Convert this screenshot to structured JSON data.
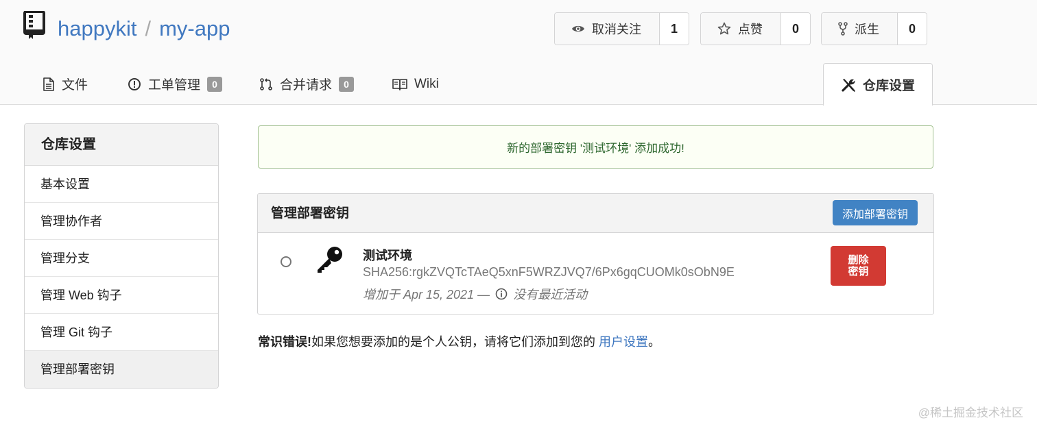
{
  "repo": {
    "owner": "happykit",
    "separator": "/",
    "name": "my-app"
  },
  "actions": [
    {
      "label": "取消关注",
      "count": "1",
      "icon": "eye-icon"
    },
    {
      "label": "点赞",
      "count": "0",
      "icon": "star-icon"
    },
    {
      "label": "派生",
      "count": "0",
      "icon": "fork-icon"
    }
  ],
  "tabs": {
    "files": {
      "label": "文件",
      "icon": "file-icon"
    },
    "issues": {
      "label": "工单管理",
      "badge": "0",
      "icon": "issue-icon"
    },
    "pulls": {
      "label": "合并请求",
      "badge": "0",
      "icon": "pull-request-icon"
    },
    "wiki": {
      "label": "Wiki",
      "icon": "book-icon"
    },
    "settings": {
      "label": "仓库设置",
      "icon": "tools-icon"
    }
  },
  "sidebar": {
    "title": "仓库设置",
    "items": [
      {
        "label": "基本设置"
      },
      {
        "label": "管理协作者"
      },
      {
        "label": "管理分支"
      },
      {
        "label": "管理 Web 钩子"
      },
      {
        "label": "管理 Git 钩子"
      },
      {
        "label": "管理部署密钥"
      }
    ]
  },
  "alert": {
    "message": "新的部署密钥 '测试环境' 添加成功!"
  },
  "deploy_keys": {
    "title": "管理部署密钥",
    "add_button": "添加部署密钥",
    "key": {
      "name": "测试环境",
      "fingerprint": "SHA256:rgkZVQTcTAeQ5xnF5WRZJVQ7/6Px6gqCUOMk0sObN9E",
      "added": "增加于 Apr 15, 2021 —",
      "activity": "没有最近活动",
      "delete_line1": "删除",
      "delete_line2": "密钥"
    }
  },
  "note": {
    "bold": "常识错误!",
    "text": "如果您想要添加的是个人公钥，请将它们添加到您的",
    "link": "用户设置",
    "end": "。"
  },
  "watermark": "@稀土掘金技术社区",
  "colors": {
    "link": "#4078c0",
    "primary_button": "#4183c4",
    "danger_button": "#d23a33",
    "success_text": "#2c662d",
    "success_border": "#a3c293"
  }
}
